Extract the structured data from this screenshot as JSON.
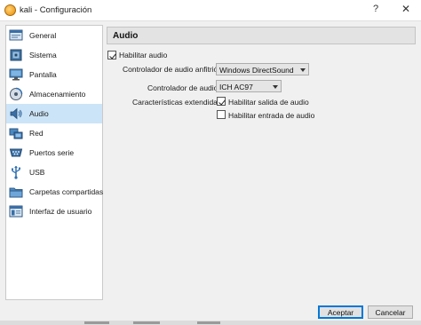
{
  "window": {
    "title": "kali - Configuración",
    "help_glyph": "?",
    "close_glyph": "✕"
  },
  "sidebar": {
    "items": [
      {
        "label": "General",
        "icon": "general-icon"
      },
      {
        "label": "Sistema",
        "icon": "system-icon"
      },
      {
        "label": "Pantalla",
        "icon": "display-icon"
      },
      {
        "label": "Almacenamiento",
        "icon": "storage-icon"
      },
      {
        "label": "Audio",
        "icon": "audio-icon",
        "selected": true
      },
      {
        "label": "Red",
        "icon": "network-icon"
      },
      {
        "label": "Puertos serie",
        "icon": "serial-ports-icon"
      },
      {
        "label": "USB",
        "icon": "usb-icon"
      },
      {
        "label": "Carpetas compartidas",
        "icon": "shared-folders-icon"
      },
      {
        "label": "Interfaz de usuario",
        "icon": "user-interface-icon"
      }
    ]
  },
  "audio": {
    "header": "Audio",
    "enable_audio": {
      "label": "Habilitar audio",
      "checked": true
    },
    "host_driver": {
      "label": "Controlador de audio anfitrión:",
      "value": "Windows DirectSound"
    },
    "controller": {
      "label": "Controlador de audio:",
      "value": "ICH AC97"
    },
    "extended": {
      "label": "Características extendidas:",
      "output": {
        "label": "Habilitar salida de audio",
        "checked": true
      },
      "input": {
        "label": "Habilitar entrada de audio",
        "checked": false
      }
    }
  },
  "buttons": {
    "accept": "Aceptar",
    "cancel": "Cancelar"
  },
  "colors": {
    "selection": "#cce4f7",
    "primary_border": "#0078d7"
  }
}
